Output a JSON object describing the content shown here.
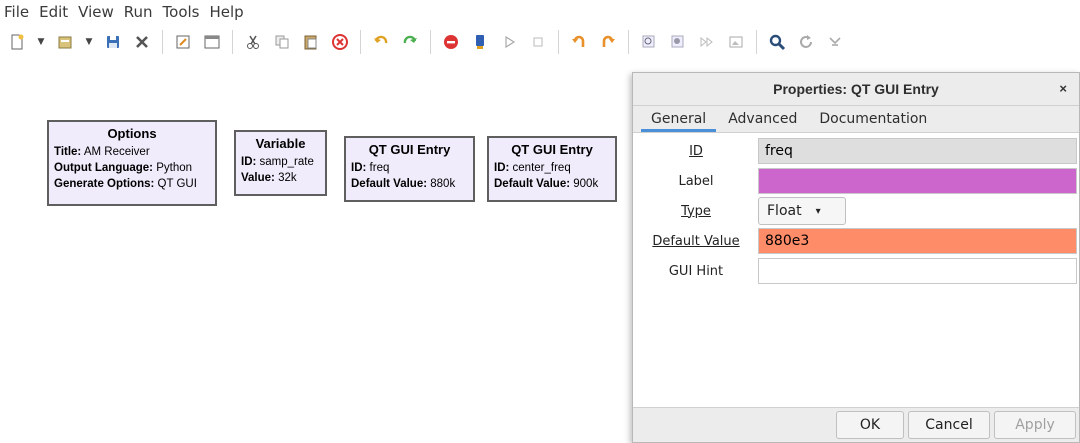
{
  "menu": [
    "File",
    "Edit",
    "View",
    "Run",
    "Tools",
    "Help"
  ],
  "toolbar": {
    "icons": [
      "new-icon",
      "dropdown-icon",
      "open-icon",
      "dropdown-icon",
      "save-icon",
      "close-icon",
      "edit-icon",
      "window-icon",
      "cut-icon",
      "copy-icon",
      "paste-icon",
      "delete-icon",
      "undo-icon",
      "redo-icon",
      "stop-icon",
      "generate-icon",
      "run-icon",
      "pause-icon",
      "rotate-ccw-icon",
      "rotate-cw-icon",
      "zoom-in-icon",
      "zoom-out-icon",
      "forward-icon",
      "image-icon",
      "find-icon",
      "reload-icon",
      "bypass-icon"
    ]
  },
  "blocks": [
    {
      "title": "Options",
      "rows": [
        {
          "k": "Title:",
          "v": " AM Receiver"
        },
        {
          "k": "Output Language:",
          "v": " Python"
        },
        {
          "k": "Generate Options:",
          "v": " QT GUI"
        }
      ]
    },
    {
      "title": "Variable",
      "rows": [
        {
          "k": "ID:",
          "v": " samp_rate"
        },
        {
          "k": "Value:",
          "v": " 32k"
        }
      ]
    },
    {
      "title": "QT GUI Entry",
      "rows": [
        {
          "k": "ID:",
          "v": " freq"
        },
        {
          "k": "Default Value:",
          "v": " 880k"
        }
      ]
    },
    {
      "title": "QT GUI Entry",
      "rows": [
        {
          "k": "ID:",
          "v": " center_freq"
        },
        {
          "k": "Default Value:",
          "v": " 900k"
        }
      ]
    }
  ],
  "dialog": {
    "title": "Properties: QT GUI Entry",
    "close": "×",
    "tabs": [
      "General",
      "Advanced",
      "Documentation"
    ],
    "fields": {
      "id": {
        "label": "ID",
        "value": "freq",
        "color": "#dedede"
      },
      "label": {
        "label": "Label",
        "value": "",
        "color": "#cc66cc"
      },
      "type": {
        "label": "Type",
        "value": "Float",
        "caret": "▾"
      },
      "default_value": {
        "label": "Default Value",
        "value": "880e3",
        "color": "#ff8c69"
      },
      "gui_hint": {
        "label": "GUI Hint",
        "value": "",
        "color": "#ffffff"
      }
    },
    "buttons": {
      "ok": "OK",
      "cancel": "Cancel",
      "apply": "Apply"
    }
  }
}
